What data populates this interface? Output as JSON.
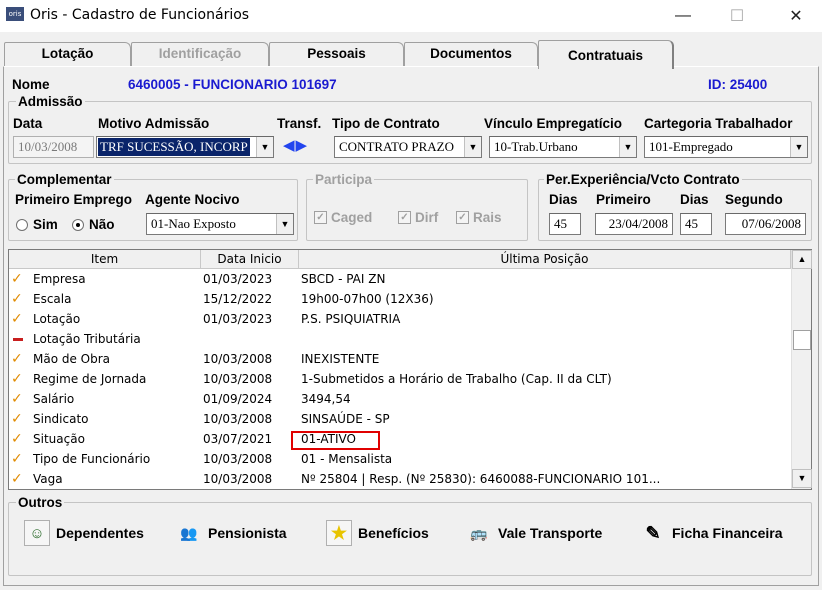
{
  "window": {
    "title": "Oris - Cadastro de Funcionários",
    "icon_text": "oris",
    "minimize": "—",
    "maximize": "☐",
    "close": "✕"
  },
  "tabs": [
    {
      "label": "Lotação",
      "state": "normal"
    },
    {
      "label": "Identificação",
      "state": "disabled"
    },
    {
      "label": "Pessoais",
      "state": "normal"
    },
    {
      "label": "Documentos",
      "state": "normal"
    },
    {
      "label": "Contratuais",
      "state": "active"
    }
  ],
  "header": {
    "nome_label": "Nome",
    "nome_value": "6460005 - FUNCIONARIO 101697",
    "id_text": "ID: 25400"
  },
  "admissao": {
    "group_title": "Admissão",
    "data_label": "Data",
    "data_value": "10/03/2008",
    "motivo_label": "Motivo Admissão",
    "motivo_value": "TRF SUCESSÃO, INCORP",
    "transf_label": "Transf.",
    "transf_arrows": "◀▶",
    "tipo_label": "Tipo de Contrato",
    "tipo_value": "CONTRATO PRAZO",
    "vinculo_label": "Vínculo Empregatício",
    "vinculo_value": "10-Trab.Urbano",
    "categoria_label": "Cartegoria Trabalhador",
    "categoria_value": "101-Empregado"
  },
  "complementar": {
    "group_title": "Complementar",
    "primeiro_label": "Primeiro Emprego",
    "sim_label": "Sim",
    "nao_label": "Não",
    "selected": "Não",
    "agente_label": "Agente Nocivo",
    "agente_value": "01-Nao Exposto"
  },
  "participa": {
    "group_title": "Participa",
    "caged": "Caged",
    "dirf": "Dirf",
    "rais": "Rais",
    "check_mark": "✓"
  },
  "experiencia": {
    "group_title": "Per.Experiência/Vcto Contrato",
    "dias1_label": "Dias",
    "primeiro_label": "Primeiro",
    "dias2_label": "Dias",
    "segundo_label": "Segundo",
    "dias1": "45",
    "primeiro": "23/04/2008",
    "dias2": "45",
    "segundo": "07/06/2008"
  },
  "grid": {
    "headers": [
      "Item",
      "Data Inicio",
      "Última Posição"
    ],
    "rows": [
      {
        "icon": "check",
        "item": "Empresa",
        "data": "01/03/2023",
        "posicao": "SBCD - PAI ZN"
      },
      {
        "icon": "check",
        "item": "Escala",
        "data": "15/12/2022",
        "posicao": "19h00-07h00 (12X36)"
      },
      {
        "icon": "check",
        "item": "Lotação",
        "data": "01/03/2023",
        "posicao": "P.S. PSIQUIATRIA"
      },
      {
        "icon": "dash",
        "item": "Lotação Tributária",
        "data": "",
        "posicao": ""
      },
      {
        "icon": "check",
        "item": "Mão de Obra",
        "data": "10/03/2008",
        "posicao": "INEXISTENTE"
      },
      {
        "icon": "check",
        "item": "Regime de Jornada",
        "data": "10/03/2008",
        "posicao": "1-Submetidos a Horário de Trabalho (Cap. II da CLT)"
      },
      {
        "icon": "check",
        "item": "Salário",
        "data": "01/09/2024",
        "posicao": "3494,54"
      },
      {
        "icon": "check",
        "item": "Sindicato",
        "data": "10/03/2008",
        "posicao": "SINSAÚDE - SP"
      },
      {
        "icon": "check",
        "item": "Situação",
        "data": "03/07/2021",
        "posicao": "01-ATIVO"
      },
      {
        "icon": "check",
        "item": "Tipo de Funcionário",
        "data": "10/03/2008",
        "posicao": "01 - Mensalista"
      },
      {
        "icon": "check",
        "item": "Vaga",
        "data": "10/03/2008",
        "posicao": "Nº 25804   | Resp. (Nº 25830): 6460088-FUNCIONARIO 101..."
      }
    ],
    "scroll_up": "▲",
    "scroll_down": "▼"
  },
  "outros": {
    "group_title": "Outros",
    "buttons": [
      {
        "label": "Dependentes",
        "icon": "person-icon",
        "glyph": "☺"
      },
      {
        "label": "Pensionista",
        "icon": "people-icon",
        "glyph": "👥"
      },
      {
        "label": "Benefícios",
        "icon": "star-icon",
        "glyph": "★"
      },
      {
        "label": "Vale Transporte",
        "icon": "bus-icon",
        "glyph": "🚌"
      },
      {
        "label": "Ficha Financeira",
        "icon": "document-icon",
        "glyph": "✎"
      }
    ]
  },
  "colors": {
    "accent_blue": "#1a1ad0",
    "highlight_red": "#e00000",
    "check_orange": "#e08a00"
  }
}
